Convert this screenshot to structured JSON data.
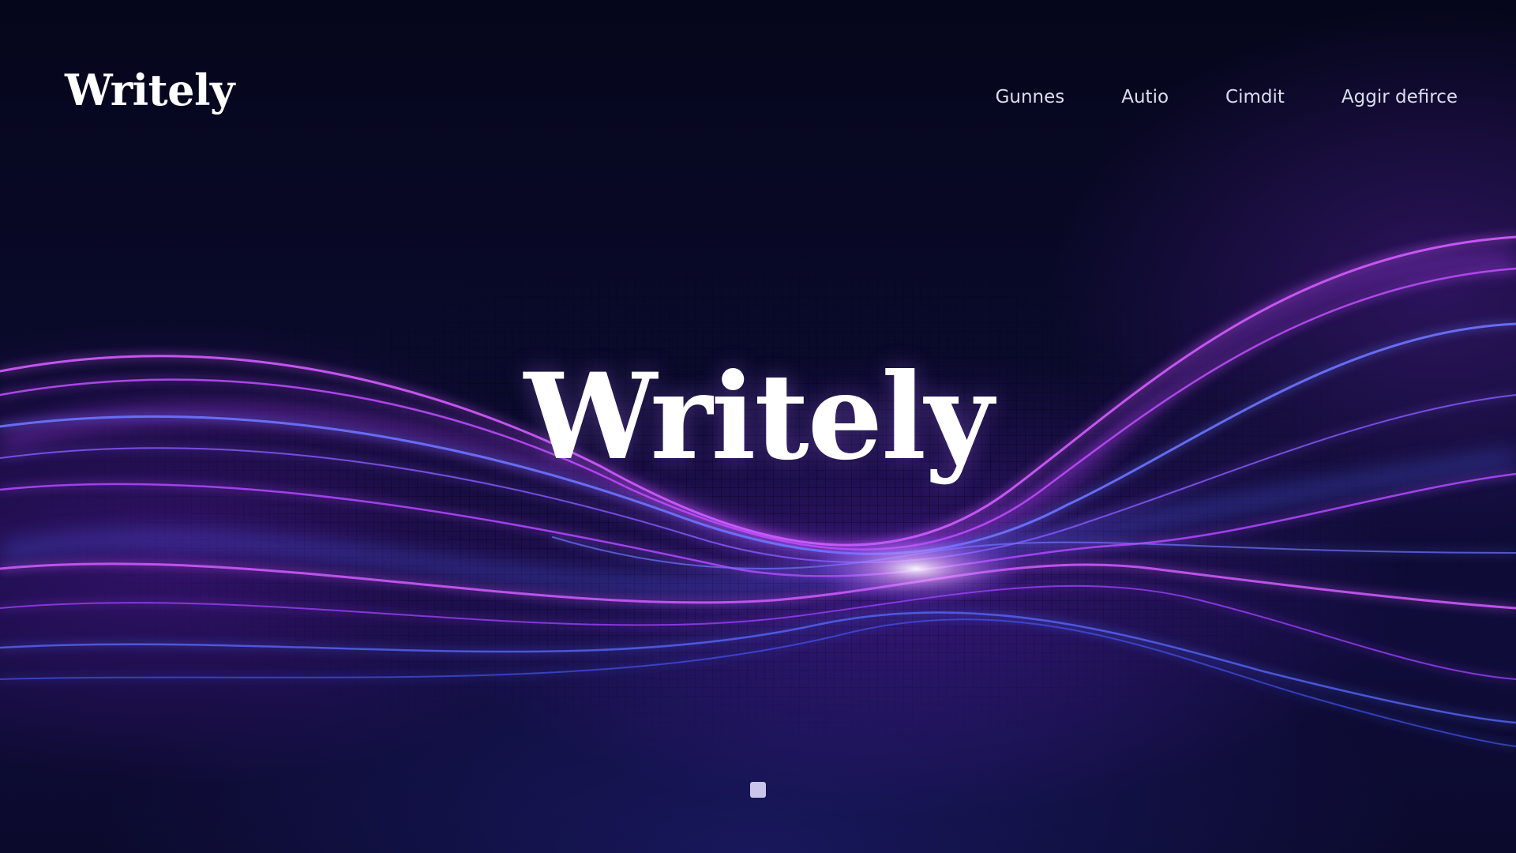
{
  "brand": {
    "logo_text": "Writely"
  },
  "nav": {
    "items": [
      {
        "label": "Gunnes"
      },
      {
        "label": "Autio"
      },
      {
        "label": "Cimdit"
      },
      {
        "label": "Aggir defirce"
      }
    ]
  },
  "hero": {
    "title": "Writely"
  },
  "theme": {
    "background": "#07071e",
    "accent_magenta": "#c24bff",
    "accent_blue": "#4d6bff",
    "text": "#ffffff"
  }
}
